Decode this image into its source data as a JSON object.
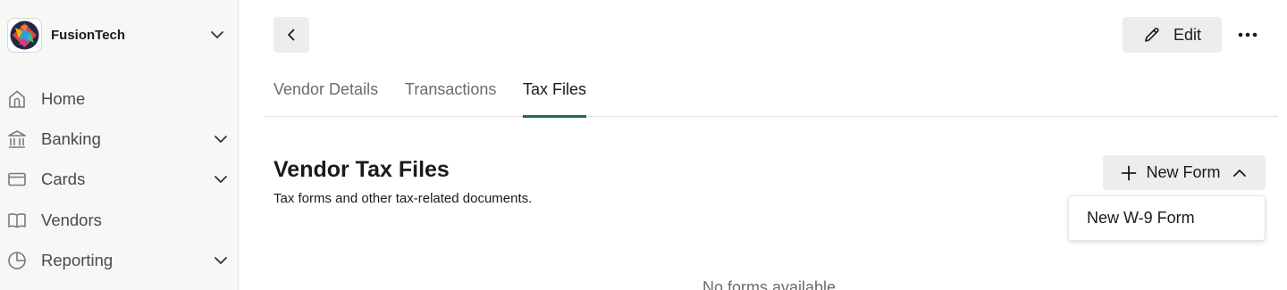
{
  "sidebar": {
    "org_name": "FusionTech",
    "items": [
      {
        "label": "Home",
        "icon": "home-icon",
        "has_chevron": false
      },
      {
        "label": "Banking",
        "icon": "bank-icon",
        "has_chevron": true
      },
      {
        "label": "Cards",
        "icon": "card-icon",
        "has_chevron": true
      },
      {
        "label": "Vendors",
        "icon": "book-icon",
        "has_chevron": false
      },
      {
        "label": "Reporting",
        "icon": "pie-chart-icon",
        "has_chevron": true
      }
    ]
  },
  "header": {
    "edit_label": "Edit"
  },
  "tabs": [
    {
      "label": "Vendor Details",
      "active": false
    },
    {
      "label": "Transactions",
      "active": false
    },
    {
      "label": "Tax Files",
      "active": true
    }
  ],
  "main": {
    "title": "Vendor Tax Files",
    "subtitle": "Tax forms and other tax-related documents.",
    "new_form_label": "New Form",
    "dropdown_items": [
      "New W-9 Form"
    ],
    "empty_text": "No forms available"
  },
  "colors": {
    "accent": "#1f6b5a",
    "button_bg": "#ededed",
    "sidebar_bg": "#f7f7f7"
  }
}
